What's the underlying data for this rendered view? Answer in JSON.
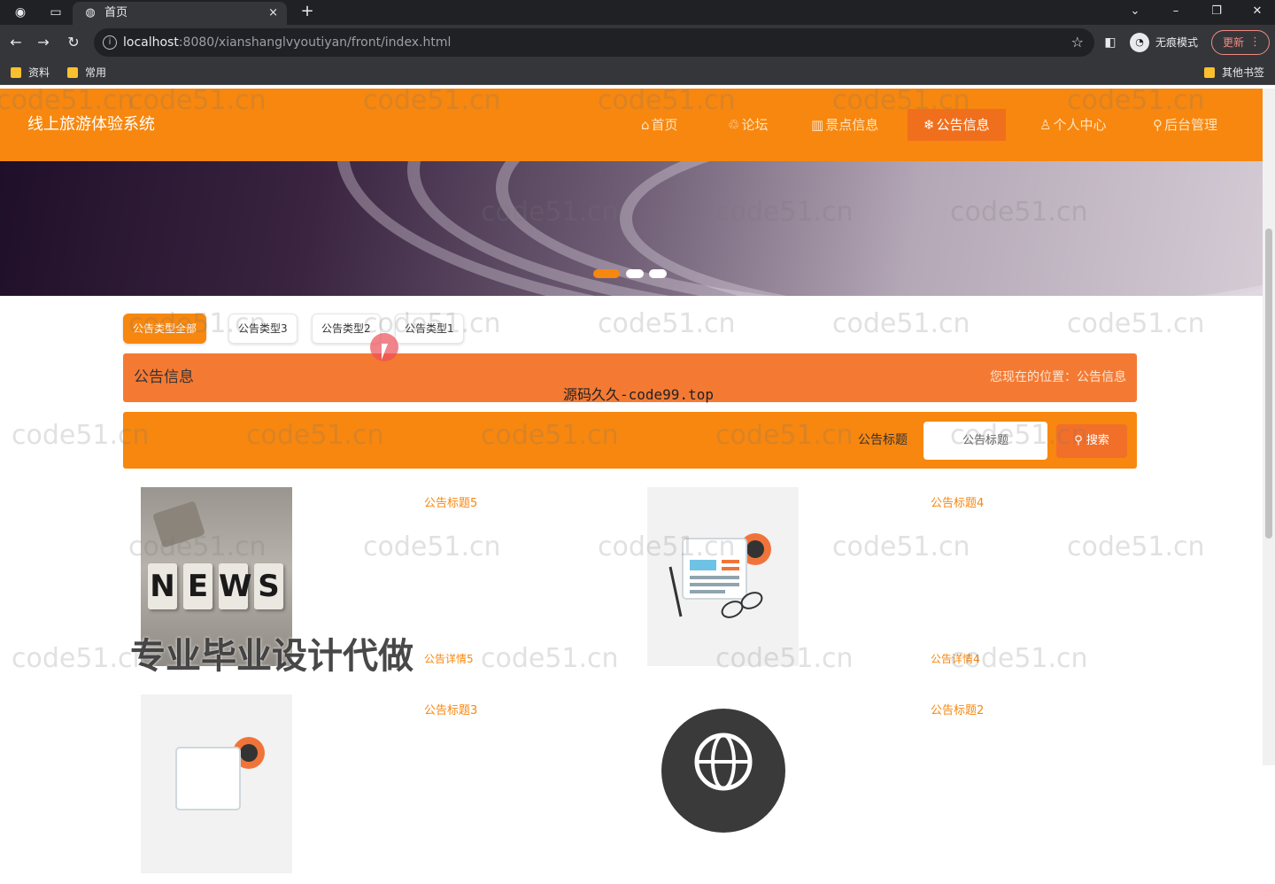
{
  "browser": {
    "tab_title": "首页",
    "tab_close": "×",
    "new_tab": "+",
    "url_host": "localhost",
    "url_path": ":8080/xianshanglvyoutiyan/front/index.html",
    "incognito_label": "无痕模式",
    "update_label": "更新",
    "bookmarks": [
      "资料",
      "常用"
    ],
    "other_bookmarks": "其他书签"
  },
  "site": {
    "title": "线上旅游体验系统",
    "nav": [
      {
        "icon": "⌂",
        "label": "首页"
      },
      {
        "icon": "♲",
        "label": "论坛"
      },
      {
        "icon": "▥",
        "label": "景点信息"
      },
      {
        "icon": "❄",
        "label": "公告信息"
      },
      {
        "icon": "♙",
        "label": "个人中心"
      },
      {
        "icon": "⚲",
        "label": "后台管理"
      }
    ],
    "active_nav_index": 3,
    "accent_color": "#f7870f"
  },
  "filters": [
    "公告类型全部",
    "公告类型3",
    "公告类型2",
    "公告类型1"
  ],
  "section": {
    "title": "公告信息",
    "location": "您现在的位置：公告信息"
  },
  "search": {
    "label": "公告标题",
    "placeholder": "公告标题",
    "button": "搜索"
  },
  "cards": [
    {
      "title": "公告标题5",
      "detail": "公告详情5"
    },
    {
      "title": "公告标题4",
      "detail": "公告详情4"
    },
    {
      "title": "公告标题3"
    },
    {
      "title": "公告标题2"
    }
  ],
  "watermarks": {
    "repeat": "code51.cn",
    "center": "源码久久-code99.top",
    "bottom": "专业毕业设计代做"
  }
}
